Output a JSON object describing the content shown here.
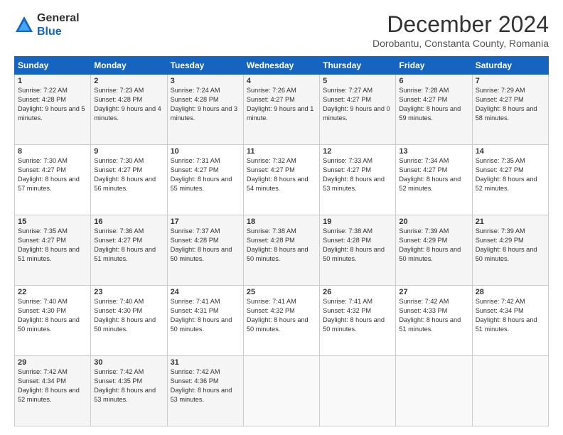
{
  "header": {
    "logo": {
      "general": "General",
      "blue": "Blue"
    },
    "title": "December 2024",
    "location": "Dorobantu, Constanta County, Romania"
  },
  "weekdays": [
    "Sunday",
    "Monday",
    "Tuesday",
    "Wednesday",
    "Thursday",
    "Friday",
    "Saturday"
  ],
  "weeks": [
    [
      {
        "day": "1",
        "sunrise": "Sunrise: 7:22 AM",
        "sunset": "Sunset: 4:28 PM",
        "daylight": "Daylight: 9 hours and 5 minutes."
      },
      {
        "day": "2",
        "sunrise": "Sunrise: 7:23 AM",
        "sunset": "Sunset: 4:28 PM",
        "daylight": "Daylight: 9 hours and 4 minutes."
      },
      {
        "day": "3",
        "sunrise": "Sunrise: 7:24 AM",
        "sunset": "Sunset: 4:28 PM",
        "daylight": "Daylight: 9 hours and 3 minutes."
      },
      {
        "day": "4",
        "sunrise": "Sunrise: 7:26 AM",
        "sunset": "Sunset: 4:27 PM",
        "daylight": "Daylight: 9 hours and 1 minute."
      },
      {
        "day": "5",
        "sunrise": "Sunrise: 7:27 AM",
        "sunset": "Sunset: 4:27 PM",
        "daylight": "Daylight: 9 hours and 0 minutes."
      },
      {
        "day": "6",
        "sunrise": "Sunrise: 7:28 AM",
        "sunset": "Sunset: 4:27 PM",
        "daylight": "Daylight: 8 hours and 59 minutes."
      },
      {
        "day": "7",
        "sunrise": "Sunrise: 7:29 AM",
        "sunset": "Sunset: 4:27 PM",
        "daylight": "Daylight: 8 hours and 58 minutes."
      }
    ],
    [
      {
        "day": "8",
        "sunrise": "Sunrise: 7:30 AM",
        "sunset": "Sunset: 4:27 PM",
        "daylight": "Daylight: 8 hours and 57 minutes."
      },
      {
        "day": "9",
        "sunrise": "Sunrise: 7:30 AM",
        "sunset": "Sunset: 4:27 PM",
        "daylight": "Daylight: 8 hours and 56 minutes."
      },
      {
        "day": "10",
        "sunrise": "Sunrise: 7:31 AM",
        "sunset": "Sunset: 4:27 PM",
        "daylight": "Daylight: 8 hours and 55 minutes."
      },
      {
        "day": "11",
        "sunrise": "Sunrise: 7:32 AM",
        "sunset": "Sunset: 4:27 PM",
        "daylight": "Daylight: 8 hours and 54 minutes."
      },
      {
        "day": "12",
        "sunrise": "Sunrise: 7:33 AM",
        "sunset": "Sunset: 4:27 PM",
        "daylight": "Daylight: 8 hours and 53 minutes."
      },
      {
        "day": "13",
        "sunrise": "Sunrise: 7:34 AM",
        "sunset": "Sunset: 4:27 PM",
        "daylight": "Daylight: 8 hours and 52 minutes."
      },
      {
        "day": "14",
        "sunrise": "Sunrise: 7:35 AM",
        "sunset": "Sunset: 4:27 PM",
        "daylight": "Daylight: 8 hours and 52 minutes."
      }
    ],
    [
      {
        "day": "15",
        "sunrise": "Sunrise: 7:35 AM",
        "sunset": "Sunset: 4:27 PM",
        "daylight": "Daylight: 8 hours and 51 minutes."
      },
      {
        "day": "16",
        "sunrise": "Sunrise: 7:36 AM",
        "sunset": "Sunset: 4:27 PM",
        "daylight": "Daylight: 8 hours and 51 minutes."
      },
      {
        "day": "17",
        "sunrise": "Sunrise: 7:37 AM",
        "sunset": "Sunset: 4:28 PM",
        "daylight": "Daylight: 8 hours and 50 minutes."
      },
      {
        "day": "18",
        "sunrise": "Sunrise: 7:38 AM",
        "sunset": "Sunset: 4:28 PM",
        "daylight": "Daylight: 8 hours and 50 minutes."
      },
      {
        "day": "19",
        "sunrise": "Sunrise: 7:38 AM",
        "sunset": "Sunset: 4:28 PM",
        "daylight": "Daylight: 8 hours and 50 minutes."
      },
      {
        "day": "20",
        "sunrise": "Sunrise: 7:39 AM",
        "sunset": "Sunset: 4:29 PM",
        "daylight": "Daylight: 8 hours and 50 minutes."
      },
      {
        "day": "21",
        "sunrise": "Sunrise: 7:39 AM",
        "sunset": "Sunset: 4:29 PM",
        "daylight": "Daylight: 8 hours and 50 minutes."
      }
    ],
    [
      {
        "day": "22",
        "sunrise": "Sunrise: 7:40 AM",
        "sunset": "Sunset: 4:30 PM",
        "daylight": "Daylight: 8 hours and 50 minutes."
      },
      {
        "day": "23",
        "sunrise": "Sunrise: 7:40 AM",
        "sunset": "Sunset: 4:30 PM",
        "daylight": "Daylight: 8 hours and 50 minutes."
      },
      {
        "day": "24",
        "sunrise": "Sunrise: 7:41 AM",
        "sunset": "Sunset: 4:31 PM",
        "daylight": "Daylight: 8 hours and 50 minutes."
      },
      {
        "day": "25",
        "sunrise": "Sunrise: 7:41 AM",
        "sunset": "Sunset: 4:32 PM",
        "daylight": "Daylight: 8 hours and 50 minutes."
      },
      {
        "day": "26",
        "sunrise": "Sunrise: 7:41 AM",
        "sunset": "Sunset: 4:32 PM",
        "daylight": "Daylight: 8 hours and 50 minutes."
      },
      {
        "day": "27",
        "sunrise": "Sunrise: 7:42 AM",
        "sunset": "Sunset: 4:33 PM",
        "daylight": "Daylight: 8 hours and 51 minutes."
      },
      {
        "day": "28",
        "sunrise": "Sunrise: 7:42 AM",
        "sunset": "Sunset: 4:34 PM",
        "daylight": "Daylight: 8 hours and 51 minutes."
      }
    ],
    [
      {
        "day": "29",
        "sunrise": "Sunrise: 7:42 AM",
        "sunset": "Sunset: 4:34 PM",
        "daylight": "Daylight: 8 hours and 52 minutes."
      },
      {
        "day": "30",
        "sunrise": "Sunrise: 7:42 AM",
        "sunset": "Sunset: 4:35 PM",
        "daylight": "Daylight: 8 hours and 53 minutes."
      },
      {
        "day": "31",
        "sunrise": "Sunrise: 7:42 AM",
        "sunset": "Sunset: 4:36 PM",
        "daylight": "Daylight: 8 hours and 53 minutes."
      },
      null,
      null,
      null,
      null
    ]
  ]
}
